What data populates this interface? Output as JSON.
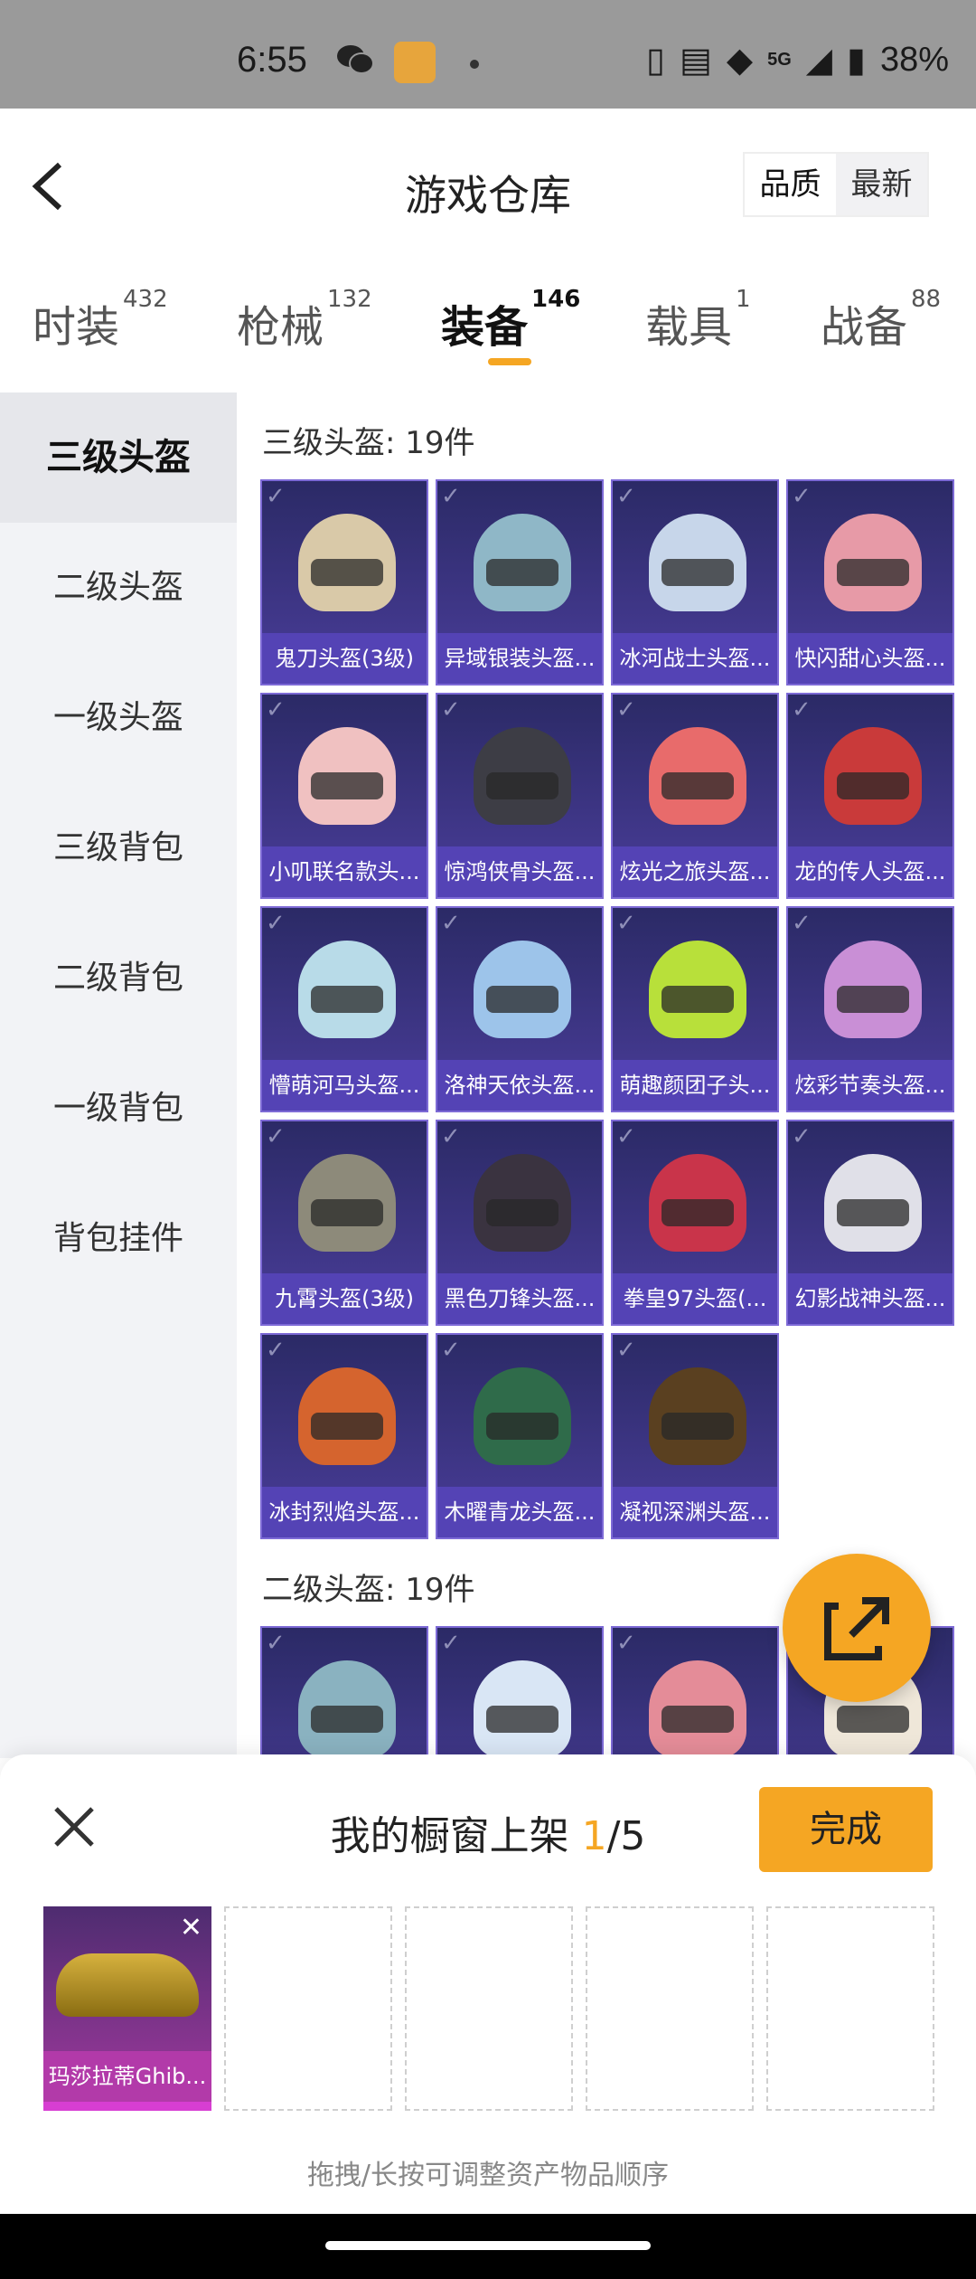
{
  "status": {
    "time": "6:55",
    "network": "5G",
    "battery": "38%"
  },
  "header": {
    "title": "游戏仓库",
    "sort": [
      "品质",
      "最新"
    ]
  },
  "tabs": [
    {
      "label": "时装",
      "count": "432"
    },
    {
      "label": "枪械",
      "count": "132"
    },
    {
      "label": "装备",
      "count": "146"
    },
    {
      "label": "载具",
      "count": "1"
    },
    {
      "label": "战备",
      "count": "88"
    }
  ],
  "sidebar": [
    "三级头盔",
    "二级头盔",
    "一级头盔",
    "三级背包",
    "二级背包",
    "一级背包",
    "背包挂件"
  ],
  "sections": [
    {
      "title": "三级头盔: 19件",
      "items": [
        {
          "name": "鬼刀头盔(3级)",
          "color": "#d9c9a8"
        },
        {
          "name": "异域银装头盔...",
          "color": "#8fb7c7"
        },
        {
          "name": "冰河战士头盔...",
          "color": "#c7d6ea"
        },
        {
          "name": "快闪甜心头盔...",
          "color": "#e79aa7"
        },
        {
          "name": "小叽联名款头...",
          "color": "#f0c1c1"
        },
        {
          "name": "惊鸿侠骨头盔...",
          "color": "#3d3d45"
        },
        {
          "name": "炫光之旅头盔...",
          "color": "#e86b6b"
        },
        {
          "name": "龙的传人头盔...",
          "color": "#c93a3a"
        },
        {
          "name": "懵萌河马头盔...",
          "color": "#b8dbe8"
        },
        {
          "name": "洛神天依头盔...",
          "color": "#9dc4ea"
        },
        {
          "name": "萌趣颜团子头...",
          "color": "#b8e03a"
        },
        {
          "name": "炫彩节奏头盔...",
          "color": "#c98fd6"
        },
        {
          "name": "九霄头盔(3级)",
          "color": "#8d8a7a"
        },
        {
          "name": "黑色刀锋头盔...",
          "color": "#3a3340"
        },
        {
          "name": "拳皇97头盔(...",
          "color": "#c9344a"
        },
        {
          "name": "幻影战神头盔...",
          "color": "#e0e0e8"
        },
        {
          "name": "冰封烈焰头盔...",
          "color": "#d5642e"
        },
        {
          "name": "木曜青龙头盔...",
          "color": "#2f6b4a"
        },
        {
          "name": "凝视深渊头盔...",
          "color": "#5a4020"
        }
      ]
    },
    {
      "title": "二级头盔: 19件",
      "items": [
        {
          "name": "",
          "color": "#8ab2c0"
        },
        {
          "name": "",
          "color": "#d9e6f5"
        },
        {
          "name": "",
          "color": "#e48c98"
        },
        {
          "name": "",
          "color": "#efe7d9"
        }
      ]
    }
  ],
  "panel": {
    "title_prefix": "我的橱窗上架 ",
    "current": "1",
    "total": "/5",
    "done": "完成",
    "item": "玛莎拉蒂Ghib...",
    "hint": "拖拽/长按可调整资产物品顺序"
  }
}
